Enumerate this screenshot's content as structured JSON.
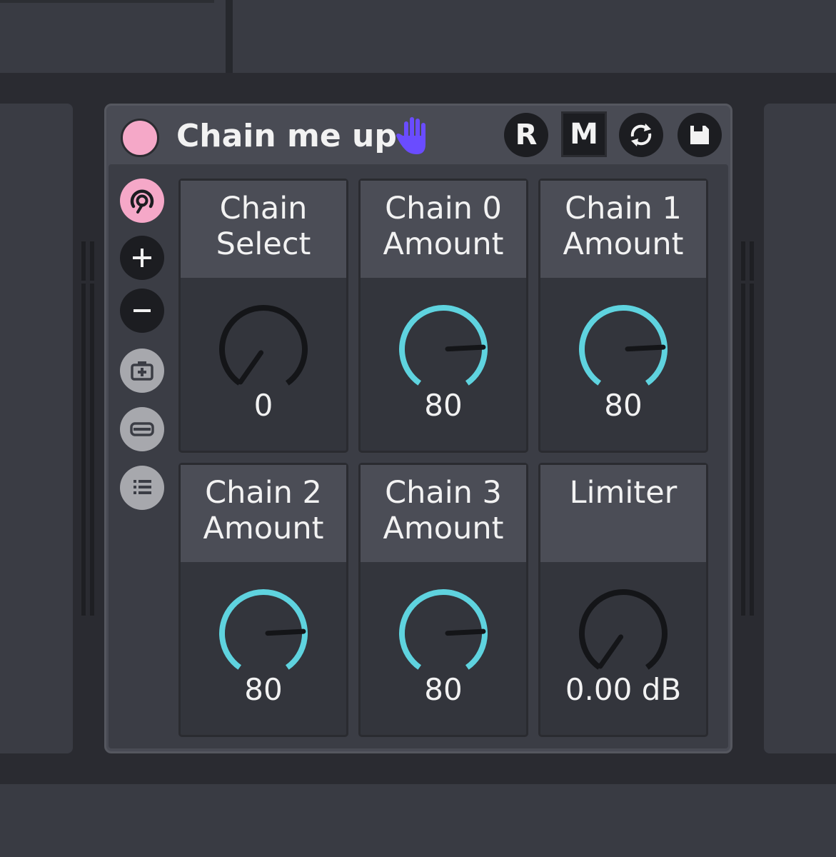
{
  "device": {
    "title": "Chain me up",
    "header_buttons": {
      "r": "R",
      "m": "M"
    },
    "power_color": "#f5a8c8",
    "hand_icon_color": "#6a4cff",
    "accent_active": "#5fd3df",
    "accent_inactive": "#141518"
  },
  "icons": {
    "power": "power-toggle-icon",
    "hand": "hand-icon",
    "hot_swap": "hot-swap-icon",
    "save": "save-icon",
    "macro": "macro-map-icon",
    "plus": "plus-icon",
    "minus": "minus-icon",
    "snapshot": "snapshot-icon",
    "randomize": "randomize-icon",
    "list": "list-icon"
  },
  "knobs": [
    {
      "label": "Chain\nSelect",
      "value": "0",
      "fraction": 0.0,
      "active": false
    },
    {
      "label": "Chain 0\nAmount",
      "value": "80",
      "fraction": 0.8,
      "active": true
    },
    {
      "label": "Chain 1\nAmount",
      "value": "80",
      "fraction": 0.8,
      "active": true
    },
    {
      "label": "Chain 2\nAmount",
      "value": "80",
      "fraction": 0.8,
      "active": true
    },
    {
      "label": "Chain 3\nAmount",
      "value": "80",
      "fraction": 0.8,
      "active": true
    },
    {
      "label": "Limiter",
      "value": "0.00 dB",
      "fraction": 0.0,
      "active": false
    }
  ]
}
